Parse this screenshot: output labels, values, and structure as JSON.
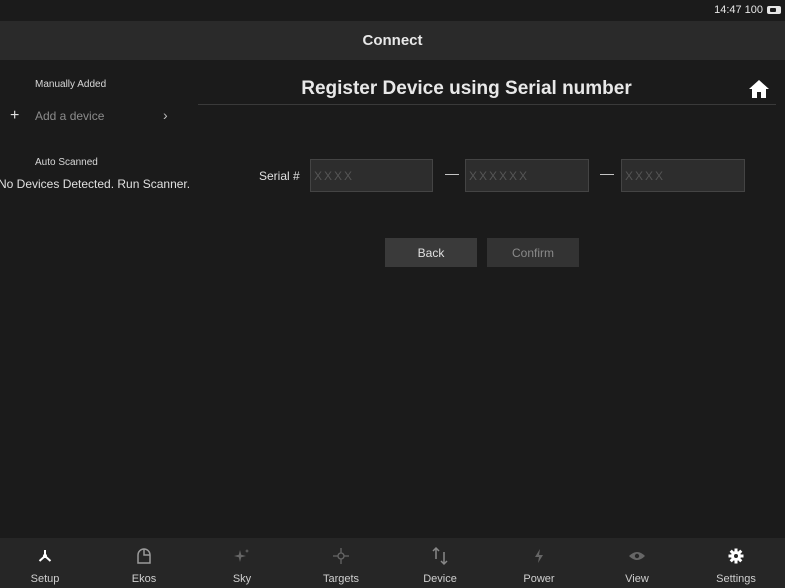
{
  "status": {
    "time": "14:47",
    "battery": "100"
  },
  "header": {
    "title": "Connect"
  },
  "sidebar": {
    "manual_label": "Manually Added",
    "add_plus": "+",
    "add_label": "Add a device",
    "add_chevron": "›",
    "auto_label": "Auto Scanned",
    "no_devices": "No Devices Detected. Run Scanner."
  },
  "main": {
    "title": "Register Device using Serial number",
    "serial_label": "Serial #",
    "serial_fields": [
      {
        "placeholder": "XXXX",
        "value": ""
      },
      {
        "placeholder": "XXXXXX",
        "value": ""
      },
      {
        "placeholder": "XXXX",
        "value": ""
      }
    ],
    "dash": "—",
    "back_label": "Back",
    "confirm_label": "Confirm"
  },
  "tabs": [
    {
      "label": "Setup",
      "icon": "setup-icon"
    },
    {
      "label": "Ekos",
      "icon": "ekos-icon"
    },
    {
      "label": "Sky",
      "icon": "sky-icon"
    },
    {
      "label": "Targets",
      "icon": "targets-icon"
    },
    {
      "label": "Device",
      "icon": "device-icon"
    },
    {
      "label": "Power",
      "icon": "power-icon"
    },
    {
      "label": "View",
      "icon": "view-icon"
    },
    {
      "label": "Settings",
      "icon": "settings-icon"
    }
  ]
}
